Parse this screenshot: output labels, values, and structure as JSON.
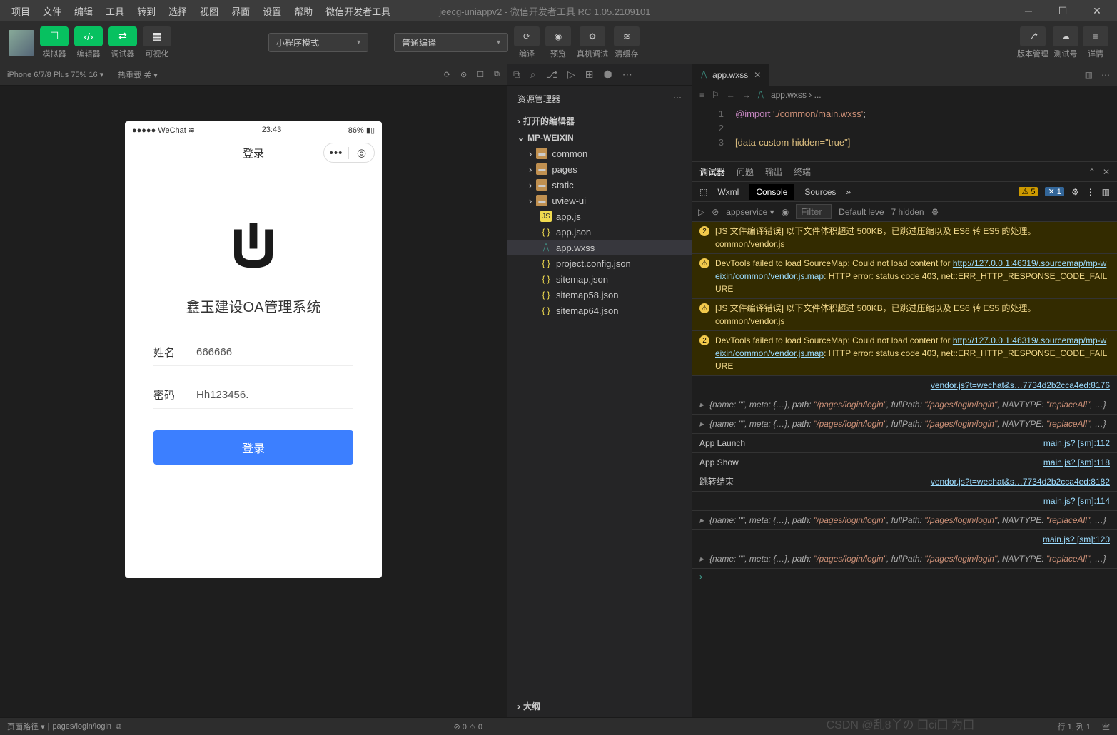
{
  "menu": [
    "项目",
    "文件",
    "编辑",
    "工具",
    "转到",
    "选择",
    "视图",
    "界面",
    "设置",
    "帮助",
    "微信开发者工具"
  ],
  "title": "jeecg-uniappv2 - 微信开发者工具 RC 1.05.2109101",
  "toolbar": {
    "sim": "模拟器",
    "editor": "编辑器",
    "debugger": "调试器",
    "visual": "可视化",
    "mode": "小程序模式",
    "compile": "普通编译",
    "compile_btn": "编译",
    "preview": "预览",
    "remote": "真机调试",
    "clear": "清缓存",
    "version": "版本管理",
    "testid": "测试号",
    "details": "详情"
  },
  "sim": {
    "device": "iPhone 6/7/8 Plus 75% 16 ▾",
    "hot": "热重载 关 ▾",
    "carrier": "●●●●● WeChat",
    "wifi": "⋮≋",
    "time": "23:43",
    "battery": "86%",
    "page_title": "登录",
    "app_name": "鑫玉建设OA管理系统",
    "name_label": "姓名",
    "name_val": "666666",
    "pwd_label": "密码",
    "pwd_val": "Hh123456.",
    "login": "登录"
  },
  "explorer": {
    "title": "资源管理器",
    "open_editors": "打开的编辑器",
    "project": "MP-WEIXIN",
    "folders": [
      "common",
      "pages",
      "static",
      "uview-ui"
    ],
    "files": [
      {
        "n": "app.js",
        "t": "js"
      },
      {
        "n": "app.json",
        "t": "json"
      },
      {
        "n": "app.wxss",
        "t": "wxss",
        "sel": true
      },
      {
        "n": "project.config.json",
        "t": "json"
      },
      {
        "n": "sitemap.json",
        "t": "json"
      },
      {
        "n": "sitemap58.json",
        "t": "json"
      },
      {
        "n": "sitemap64.json",
        "t": "json"
      }
    ],
    "outline": "大纲"
  },
  "editor": {
    "tab": "app.wxss",
    "breadcrumb": "app.wxss › ...",
    "lines": [
      {
        "n": "1",
        "c": "@import './common/main.wxss';"
      },
      {
        "n": "2",
        "c": ""
      },
      {
        "n": "3",
        "c": "[data-custom-hidden=\"true\"]"
      }
    ]
  },
  "console": {
    "tabs": {
      "debugger": "调试器",
      "problems": "问题",
      "output": "输出",
      "terminal": "终端"
    },
    "devtools": [
      "Wxml",
      "Console",
      "Sources"
    ],
    "warn_count": "5",
    "info_count": "1",
    "context": "appservice",
    "filter": "Filter",
    "level": "Default leve",
    "hidden": "7 hidden",
    "logs": [
      {
        "type": "warn",
        "icon": "2",
        "text": "[JS 文件编译错误] 以下文件体积超过 500KB，已跳过压缩以及 ES6 转 ES5 的处理。\ncommon/vendor.js"
      },
      {
        "type": "warn",
        "icon": "⚠",
        "text": "DevTools failed to load SourceMap: Could not load content for ",
        "link": "http://127.0.0.1:46319/.sourcemap/mp-weixin/common/vendor.js.map",
        "after": ": HTTP error: status code 403, net::ERR_HTTP_RESPONSE_CODE_FAILURE"
      },
      {
        "type": "warn",
        "icon": "⚠",
        "text": "[JS 文件编译错误] 以下文件体积超过 500KB，已跳过压缩以及 ES6 转 ES5 的处理。\ncommon/vendor.js"
      },
      {
        "type": "warn",
        "icon": "2",
        "text": "DevTools failed to load SourceMap: Could not load content for ",
        "link": "http://127.0.0.1:46319/.sourcemap/mp-weixin/common/vendor.js.map",
        "after": ": HTTP error: status code 403, net::ERR_HTTP_RESPONSE_CODE_FAILURE"
      },
      {
        "type": "src",
        "src": "vendor.js?t=wechat&s…7734d2b2cca4ed:8176"
      },
      {
        "type": "obj",
        "text": "{name: \"\", meta: {…}, path: \"/pages/login/login\", fullPath: \"/pages/login/login\", NAVTYPE: \"replaceAll\", …}"
      },
      {
        "type": "obj",
        "text": "{name: \"\", meta: {…}, path: \"/pages/login/login\", fullPath: \"/pages/login/login\", NAVTYPE: \"replaceAll\", …}"
      },
      {
        "type": "info",
        "text": "App Launch",
        "src": "main.js? [sm]:112"
      },
      {
        "type": "info",
        "text": "App Show",
        "src": "main.js? [sm]:118"
      },
      {
        "type": "info",
        "text": "跳转结束",
        "src": "vendor.js?t=wechat&s…7734d2b2cca4ed:8182"
      },
      {
        "type": "src",
        "src": "main.js? [sm]:114"
      },
      {
        "type": "obj",
        "text": "{name: \"\", meta: {…}, path: \"/pages/login/login\", fullPath: \"/pages/login/login\", NAVTYPE: \"replaceAll\", …}"
      },
      {
        "type": "src",
        "src": "main.js? [sm]:120"
      },
      {
        "type": "obj",
        "text": "{name: \"\", meta: {…}, path: \"/pages/login/login\", fullPath: \"/pages/login/login\", NAVTYPE: \"replaceAll\", …}"
      }
    ]
  },
  "status": {
    "page_path_label": "页面路径 ▾",
    "page_path": "pages/login/login",
    "errs": "⊘ 0 ⚠ 0",
    "line": "行 1, 列 1",
    "spaces": "空",
    "end": ""
  },
  "watermark": "CSDN @乱8丫の 囗ci囗 为囗"
}
